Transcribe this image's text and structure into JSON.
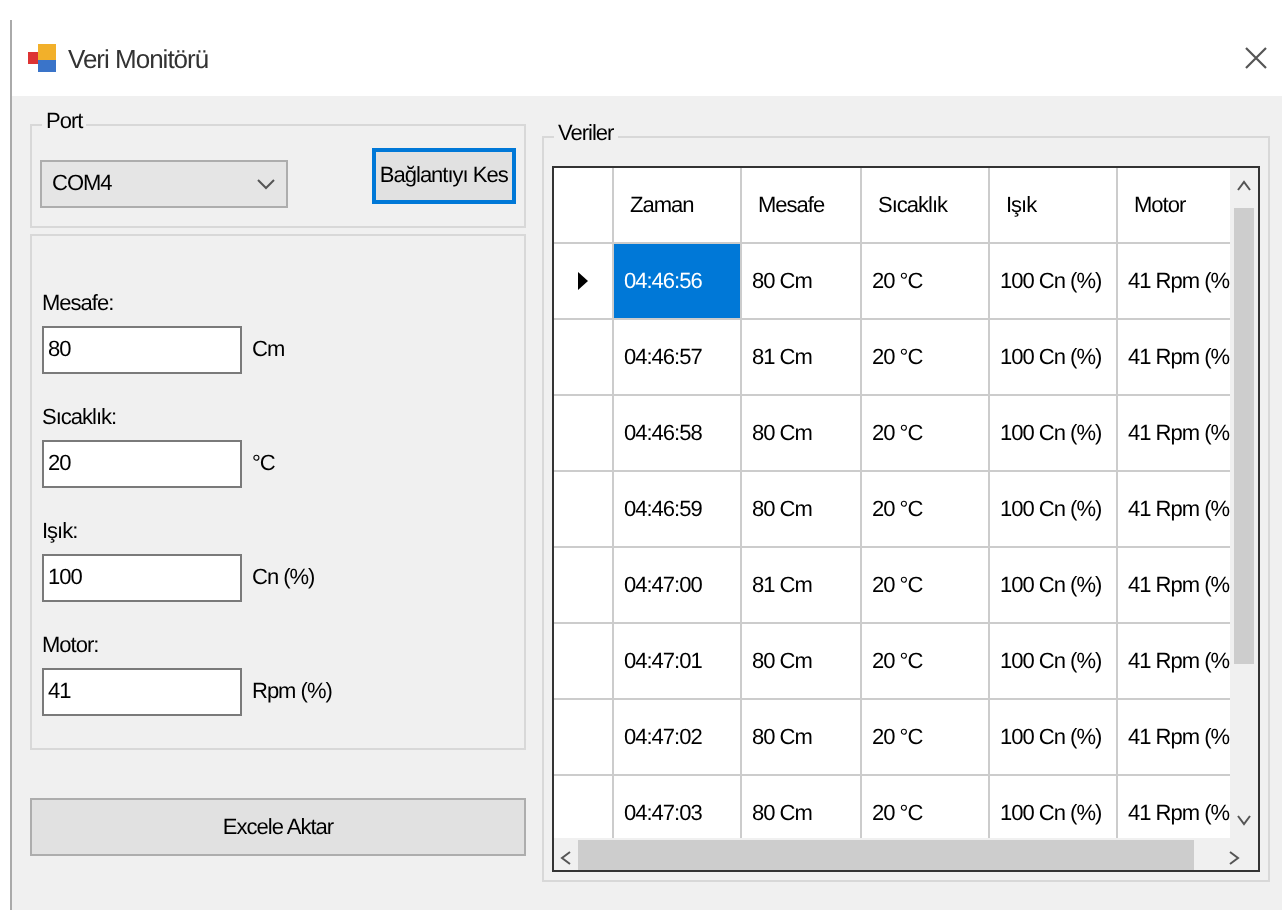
{
  "window": {
    "title": "Veri Monitörü"
  },
  "port_group": {
    "title": "Port",
    "combo": {
      "value": "COM4"
    },
    "button": "Bağlantıyı Kes"
  },
  "fields": [
    {
      "label": "Mesafe:",
      "value": "80",
      "unit": "Cm"
    },
    {
      "label": "Sıcaklık:",
      "value": "20",
      "unit": "°C"
    },
    {
      "label": "Işık:",
      "value": "100",
      "unit": "Cn (%)"
    },
    {
      "label": "Motor:",
      "value": "41",
      "unit": "Rpm (%)"
    }
  ],
  "export_button": "Excele Aktar",
  "data_group": {
    "title": "Veriler",
    "columns": [
      "Zaman",
      "Mesafe",
      "Sıcaklık",
      "Işık",
      "Motor"
    ],
    "rows": [
      {
        "current": true,
        "cells": [
          {
            "text": "04:46:56",
            "selected": true
          },
          {
            "text": "80 Cm",
            "selected": false
          },
          {
            "text": "20 °C",
            "selected": false
          },
          {
            "text": "100 Cn (%)",
            "selected": false
          },
          {
            "text": "41 Rpm (%",
            "selected": false
          }
        ]
      },
      {
        "current": false,
        "cells": [
          {
            "text": "04:46:57",
            "selected": false
          },
          {
            "text": "81 Cm",
            "selected": false
          },
          {
            "text": "20 °C",
            "selected": false
          },
          {
            "text": "100 Cn (%)",
            "selected": false
          },
          {
            "text": "41 Rpm (%",
            "selected": false
          }
        ]
      },
      {
        "current": false,
        "cells": [
          {
            "text": "04:46:58",
            "selected": false
          },
          {
            "text": "80 Cm",
            "selected": false
          },
          {
            "text": "20 °C",
            "selected": false
          },
          {
            "text": "100 Cn (%)",
            "selected": false
          },
          {
            "text": "41 Rpm (%",
            "selected": false
          }
        ]
      },
      {
        "current": false,
        "cells": [
          {
            "text": "04:46:59",
            "selected": false
          },
          {
            "text": "80 Cm",
            "selected": false
          },
          {
            "text": "20 °C",
            "selected": false
          },
          {
            "text": "100 Cn (%)",
            "selected": false
          },
          {
            "text": "41 Rpm (%",
            "selected": false
          }
        ]
      },
      {
        "current": false,
        "cells": [
          {
            "text": "04:47:00",
            "selected": false
          },
          {
            "text": "81 Cm",
            "selected": false
          },
          {
            "text": "20 °C",
            "selected": false
          },
          {
            "text": "100 Cn (%)",
            "selected": false
          },
          {
            "text": "41 Rpm (%",
            "selected": false
          }
        ]
      },
      {
        "current": false,
        "cells": [
          {
            "text": "04:47:01",
            "selected": false
          },
          {
            "text": "80 Cm",
            "selected": false
          },
          {
            "text": "20 °C",
            "selected": false
          },
          {
            "text": "100 Cn (%)",
            "selected": false
          },
          {
            "text": "41 Rpm (%",
            "selected": false
          }
        ]
      },
      {
        "current": false,
        "cells": [
          {
            "text": "04:47:02",
            "selected": false
          },
          {
            "text": "80 Cm",
            "selected": false
          },
          {
            "text": "20 °C",
            "selected": false
          },
          {
            "text": "100 Cn (%)",
            "selected": false
          },
          {
            "text": "41 Rpm (%",
            "selected": false
          }
        ]
      },
      {
        "current": false,
        "cells": [
          {
            "text": "04:47:03",
            "selected": false
          },
          {
            "text": "80 Cm",
            "selected": false
          },
          {
            "text": "20 °C",
            "selected": false
          },
          {
            "text": "100 Cn (%)",
            "selected": false
          },
          {
            "text": "41 Rpm (%",
            "selected": false
          }
        ]
      }
    ]
  }
}
